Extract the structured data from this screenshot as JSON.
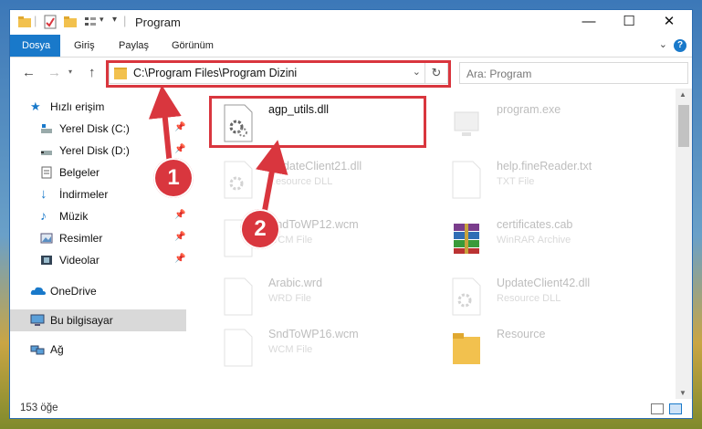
{
  "window": {
    "title": "Program"
  },
  "window_controls": {
    "minimize": "—",
    "maximize": "☐",
    "close": "✕"
  },
  "ribbon": {
    "tabs": [
      {
        "label": "Dosya",
        "active": true
      },
      {
        "label": "Giriş"
      },
      {
        "label": "Paylaş"
      },
      {
        "label": "Görünüm"
      }
    ],
    "help": "?"
  },
  "nav": {
    "back": "←",
    "forward": "→",
    "up": "↑",
    "address": "C:\\Program Files\\Program Dizini",
    "search_placeholder": "Ara: Program"
  },
  "sidebar": {
    "items": [
      {
        "label": "Hızlı erişim"
      },
      {
        "label": "Yerel Disk (C:)"
      },
      {
        "label": "Yerel Disk (D:)"
      },
      {
        "label": "Belgeler"
      },
      {
        "label": "İndirmeler"
      },
      {
        "label": "Müzik"
      },
      {
        "label": "Resimler"
      },
      {
        "label": "Videolar"
      },
      {
        "label": "OneDrive"
      },
      {
        "label": "Bu bilgisayar",
        "selected": true
      },
      {
        "label": "Ağ"
      }
    ]
  },
  "files": [
    {
      "name": "agp_utils.dll",
      "type": "",
      "icon": "dll-gear-icon"
    },
    {
      "name": "program.exe",
      "type": "",
      "icon": "exe-icon"
    },
    {
      "name": "UpdateClient21.dll",
      "type": "Resource DLL",
      "icon": "dll-gear-icon"
    },
    {
      "name": "help.fineReader.txt",
      "type": "TXT File",
      "icon": "text-file-icon"
    },
    {
      "name": "SndToWP12.wcm",
      "type": "WCM File",
      "icon": "blank-file-icon"
    },
    {
      "name": "certificates.cab",
      "type": "WinRAR Archive",
      "icon": "winrar-icon"
    },
    {
      "name": "Arabic.wrd",
      "type": "WRD File",
      "icon": "blank-file-icon"
    },
    {
      "name": "UpdateClient42.dll",
      "type": "Resource DLL",
      "icon": "dll-gear-icon"
    },
    {
      "name": "SndToWP16.wcm",
      "type": "WCM File",
      "icon": "blank-file-icon"
    },
    {
      "name": "Resource",
      "type": "",
      "icon": "folder-icon"
    }
  ],
  "status": {
    "count": "153 öğe"
  },
  "annotations": {
    "one": "1",
    "two": "2"
  },
  "colors": {
    "accent": "#1979ca",
    "highlight": "#d9363e"
  }
}
